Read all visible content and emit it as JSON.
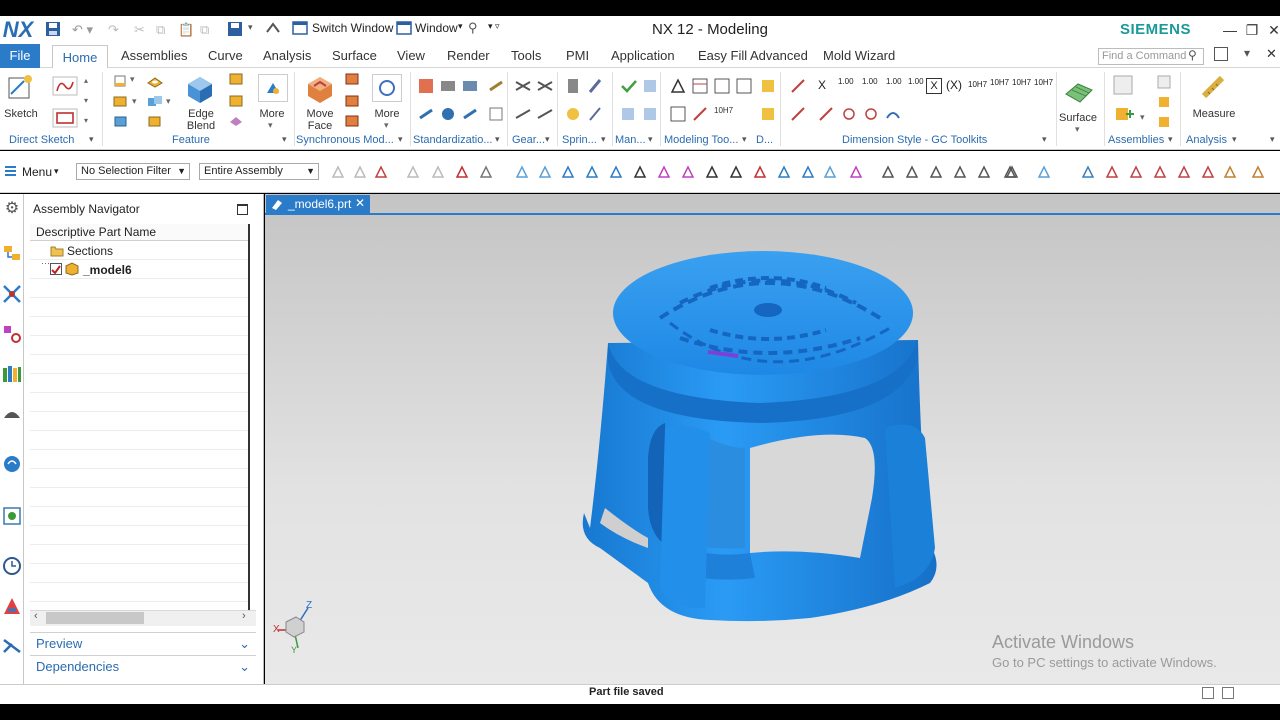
{
  "app": {
    "title": "NX 12 - Modeling",
    "logo": "NX",
    "brand": "SIEMENS"
  },
  "quick_access": {
    "switch_window": "Switch Window",
    "window": "Window"
  },
  "tabs": [
    {
      "label": "File"
    },
    {
      "label": "Home"
    },
    {
      "label": "Assemblies"
    },
    {
      "label": "Curve"
    },
    {
      "label": "Analysis"
    },
    {
      "label": "Surface"
    },
    {
      "label": "View"
    },
    {
      "label": "Render"
    },
    {
      "label": "Tools"
    },
    {
      "label": "PMI"
    },
    {
      "label": "Application"
    },
    {
      "label": "Easy Fill Advanced"
    },
    {
      "label": "Mold Wizard"
    }
  ],
  "search": {
    "placeholder": "Find a Command"
  },
  "ribbon": {
    "sketch": "Sketch",
    "edge_blend_1": "Edge",
    "edge_blend_2": "Blend",
    "more_feature": "More",
    "move_face_1": "Move",
    "move_face_2": "Face",
    "more_sync": "More",
    "surface": "Surface",
    "measure": "Measure",
    "groups": {
      "direct_sketch": "Direct Sketch",
      "feature": "Feature",
      "synchronous": "Synchronous Mod...",
      "standardization": "Standardizatio...",
      "gear": "Gear...",
      "spring": "Sprin...",
      "man": "Man...",
      "modeling_tools": "Modeling Too...",
      "d": "D...",
      "dimension_style": "Dimension Style - GC Toolkits",
      "assemblies": "Assemblies",
      "analysis": "Analysis"
    },
    "small_texts": [
      "1.00",
      "1.00",
      "1.00",
      "1.00",
      "X",
      "(X)",
      "10H7",
      "10H7",
      "10H7",
      "10H7",
      "10H7"
    ]
  },
  "selection": {
    "menu": "Menu",
    "filter": "No Selection Filter",
    "scope": "Entire Assembly"
  },
  "navigator": {
    "title": "Assembly Navigator",
    "column": "Descriptive Part Name",
    "rows": [
      {
        "label": "Sections"
      },
      {
        "label": "_model6"
      }
    ],
    "preview": "Preview",
    "dependencies": "Dependencies"
  },
  "document_tab": {
    "label": "_model6.prt"
  },
  "triad": {
    "x": "X",
    "y": "Y",
    "z": "Z"
  },
  "watermark": {
    "line1": "Activate Windows",
    "line2": "Go to PC settings to activate Windows."
  },
  "status": {
    "message": "Part file saved"
  },
  "colors": {
    "accent": "#2b7cc8",
    "model": "#1e90e8",
    "siemens": "#1a9a9a"
  }
}
